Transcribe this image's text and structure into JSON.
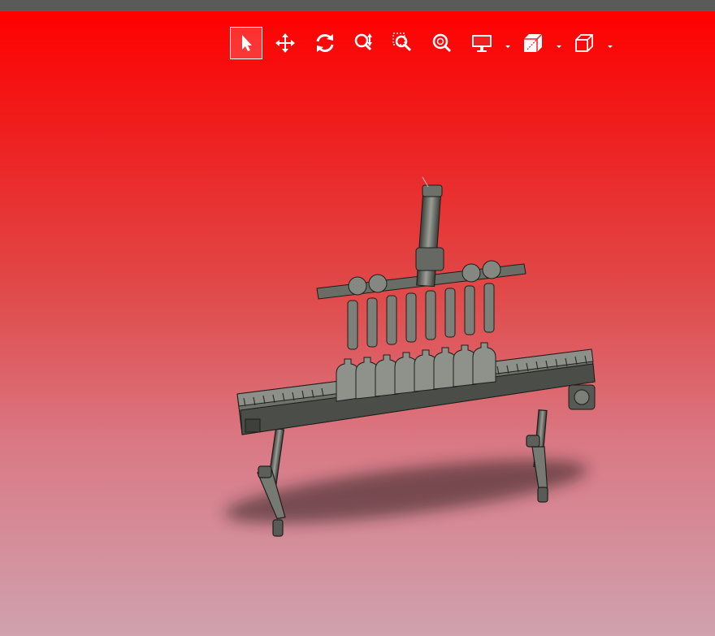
{
  "window": {
    "topbar_color": "#5a5a5a"
  },
  "viewport": {
    "background_top": "#ff0000",
    "background_bottom": "#cfa2ae",
    "model": "bottle-filling-machine-model",
    "shadow_color": "#2a1a1a"
  },
  "toolbar": {
    "icon_color": "#ffffff",
    "items": [
      {
        "name": "select",
        "icon": "cursor-arrow-icon",
        "active": true
      },
      {
        "name": "pan",
        "icon": "pan-arrows-icon",
        "active": false
      },
      {
        "name": "rotate",
        "icon": "rotate-icon",
        "active": false
      },
      {
        "name": "zoom",
        "icon": "zoom-updown-icon",
        "active": false
      },
      {
        "name": "zoom-window",
        "icon": "zoom-window-icon",
        "active": false
      },
      {
        "name": "zoom-fit",
        "icon": "zoom-fit-icon",
        "active": false
      },
      {
        "name": "display-mode",
        "icon": "monitor-icon",
        "active": false,
        "has_dropdown": true
      },
      {
        "name": "section-view",
        "icon": "section-cube-icon",
        "active": false,
        "has_dropdown": true
      },
      {
        "name": "standard-views",
        "icon": "cube-view-icon",
        "active": false,
        "has_dropdown": true
      }
    ]
  }
}
